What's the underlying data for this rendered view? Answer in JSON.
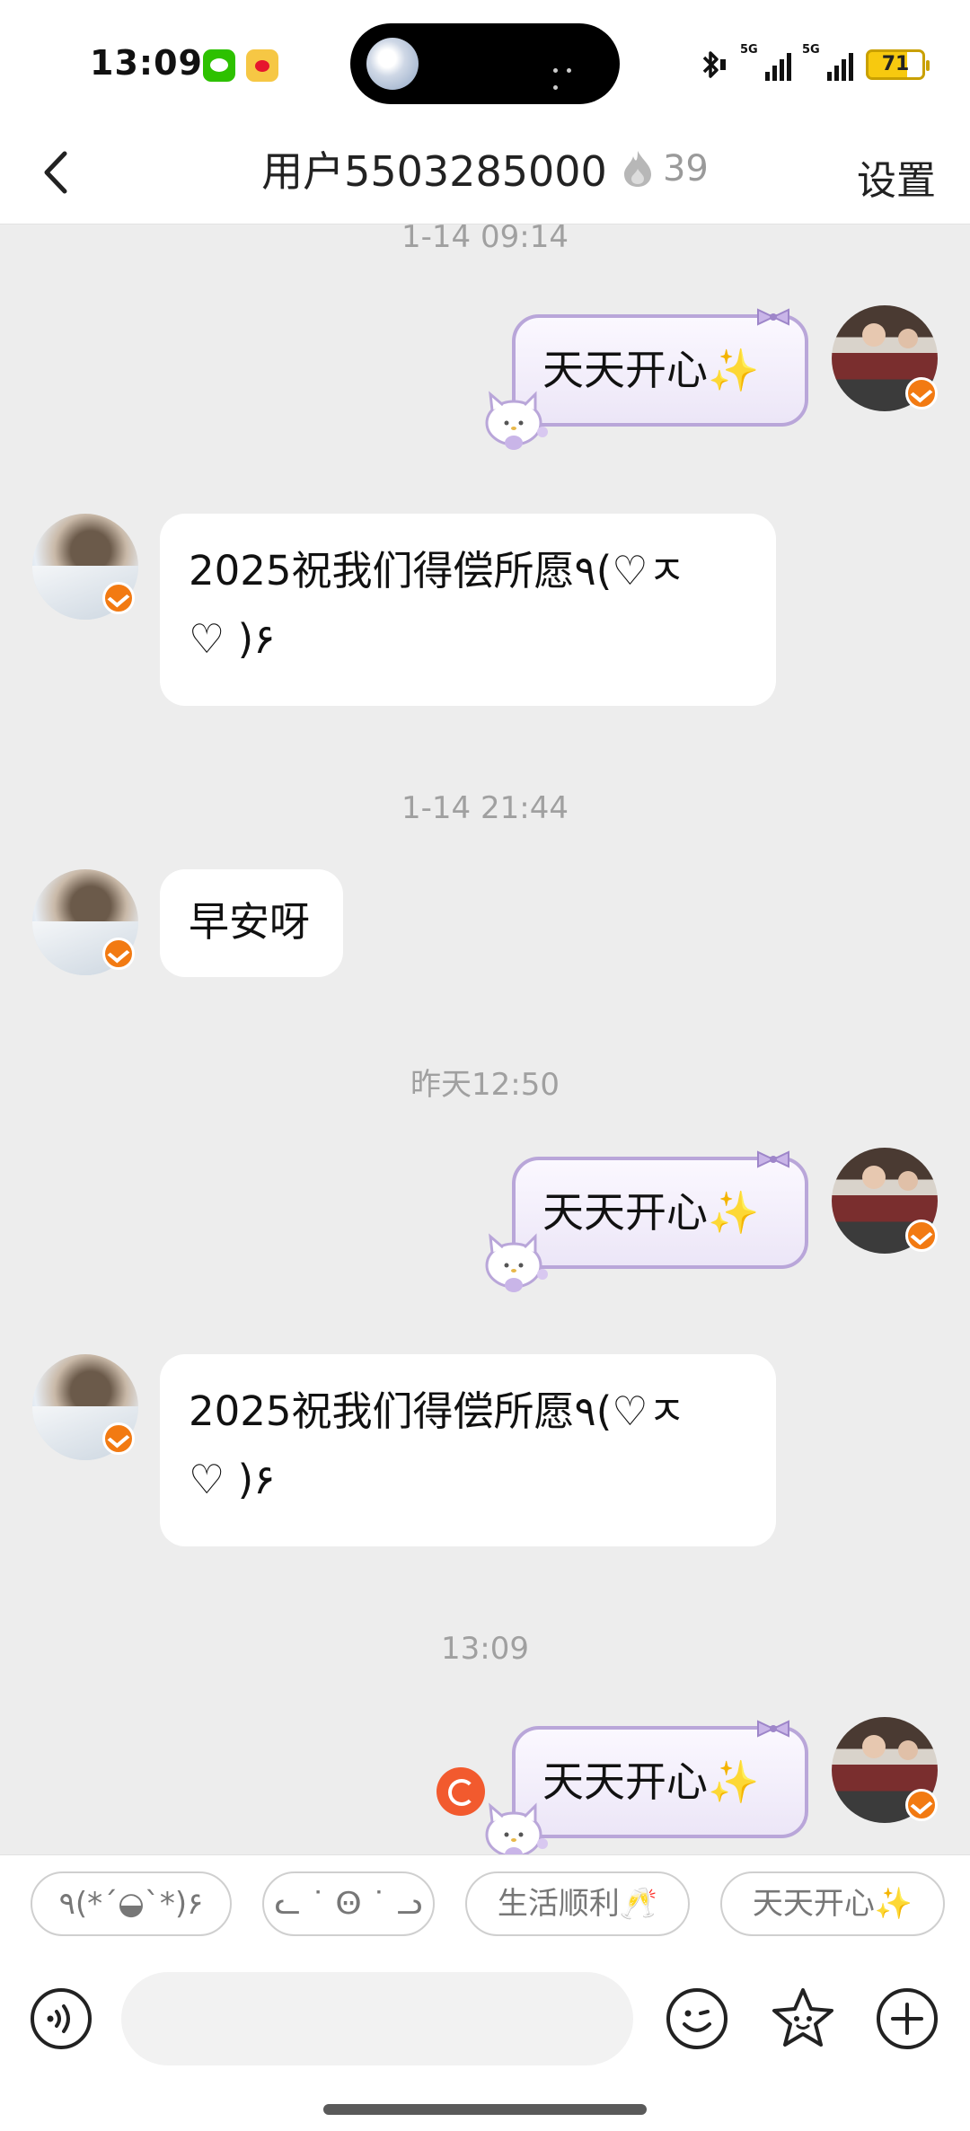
{
  "status_bar": {
    "time": "13:09",
    "signal1_label": "5G",
    "signal2_label": "5G",
    "battery_level": "71"
  },
  "header": {
    "title": "用户5503285000",
    "fire_count": "39",
    "settings_label": "设置"
  },
  "messages": [
    {
      "type": "timestamp",
      "text": "1-14 09:14"
    },
    {
      "type": "self",
      "text": "天天开心",
      "emoji": "✨"
    },
    {
      "type": "other",
      "line1": "2025祝我们得偿所愿٩(♡ㅈ",
      "line2": "♡ )۶"
    },
    {
      "type": "timestamp",
      "text": "1-14 21:44"
    },
    {
      "type": "other",
      "line1": "早安呀"
    },
    {
      "type": "timestamp",
      "text": "昨天12:50"
    },
    {
      "type": "self",
      "text": "天天开心",
      "emoji": "✨"
    },
    {
      "type": "other",
      "line1": "2025祝我们得偿所愿٩(♡ㅈ",
      "line2": "♡ )۶"
    },
    {
      "type": "timestamp",
      "text": "13:09"
    },
    {
      "type": "self",
      "text": "天天开心",
      "emoji": "✨",
      "failed": true
    }
  ],
  "quick_replies": [
    "٩(*´◒`*)۶",
    "ᓚ ˙ Ꙫ ˙ ᓗ",
    "生活顺利🥂",
    "天天开心✨"
  ],
  "input": {
    "placeholder": ""
  },
  "colors": {
    "chat_bg": "#ededed",
    "self_bubble_border": "#b9a6d9",
    "verified_badge": "#f27a12",
    "resend_red": "#f25a2e"
  },
  "icons": [
    "back-arrow-icon",
    "fire-icon",
    "voice-icon",
    "emoji-icon",
    "star-icon",
    "plus-icon",
    "resend-icon"
  ]
}
